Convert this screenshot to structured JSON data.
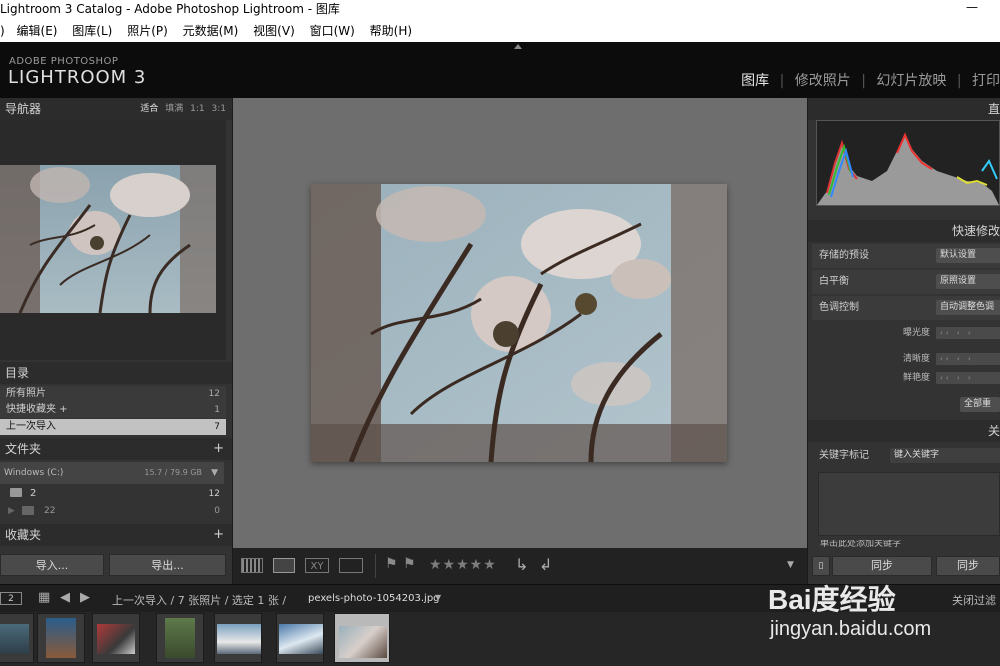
{
  "window": {
    "title": "Lightroom 3 Catalog - Adobe Photoshop Lightroom - 图库",
    "title_prefix_truncated": ")"
  },
  "menu": [
    "编辑(E)",
    "图库(L)",
    "照片(P)",
    "元数据(M)",
    "视图(V)",
    "窗口(W)",
    "帮助(H)"
  ],
  "logo": {
    "small": "ADOBE PHOTOSHOP",
    "big": "LIGHTROOM 3"
  },
  "modules": [
    {
      "label": "图库",
      "active": true
    },
    {
      "label": "修改照片",
      "active": false
    },
    {
      "label": "幻灯片放映",
      "active": false
    },
    {
      "label": "打印",
      "active": false
    }
  ],
  "navigator": {
    "title": "导航器",
    "options": [
      "适合",
      "填满",
      "1:1",
      "3:1"
    ],
    "active_option": "适合"
  },
  "catalog": {
    "title": "目录",
    "rows": [
      {
        "label": "所有照片",
        "count": "12"
      },
      {
        "label": "快捷收藏夹 +",
        "count": "1"
      },
      {
        "label": "上一次导入",
        "count": "7",
        "selected": true
      }
    ]
  },
  "folders": {
    "title": "文件夹",
    "volume": {
      "name": "Windows (C:)",
      "space": "15.7 / 79.9 GB"
    },
    "items": [
      {
        "label": "2",
        "count": "12"
      },
      {
        "label": "22",
        "count": "0"
      }
    ]
  },
  "collections": {
    "title": "收藏夹"
  },
  "left_buttons": {
    "import": "导入...",
    "export": "导出..."
  },
  "right_panel": {
    "histogram_title": "直",
    "quick_develop": {
      "title": "快速修改",
      "saved_preset": {
        "label": "存储的预设",
        "value": "默认设置"
      },
      "white_balance": {
        "label": "白平衡",
        "value": "原照设置"
      },
      "tone_control": {
        "label": "色调控制",
        "value": "自动调整色调"
      },
      "sliders": [
        "曝光度",
        "清晰度",
        "鲜艳度"
      ],
      "reset_all": "全部重"
    },
    "keywords_title": "关",
    "keyword_tags": {
      "label": "关键字标记",
      "value": "键入关键字"
    },
    "keyword_hint": "单击此处添加关键字",
    "sync_btn": "同步",
    "sync_settings_btn": "同步"
  },
  "filmbar": {
    "page": "2",
    "path": "上一次导入 / 7 张照片 / 选定 1 张 /",
    "filename": "pexels-photo-1054203.jpg",
    "filter_off": "关闭过滤"
  },
  "toolbar": {
    "stars": "★★★★★"
  },
  "watermark": {
    "brand": "Bai度经验",
    "url": "jingyan.baidu.com"
  },
  "colors": {
    "accent": "#e6e6e6",
    "panel": "#333333",
    "center": "#6e6e6e",
    "selected_row": "#c2c2c2"
  }
}
